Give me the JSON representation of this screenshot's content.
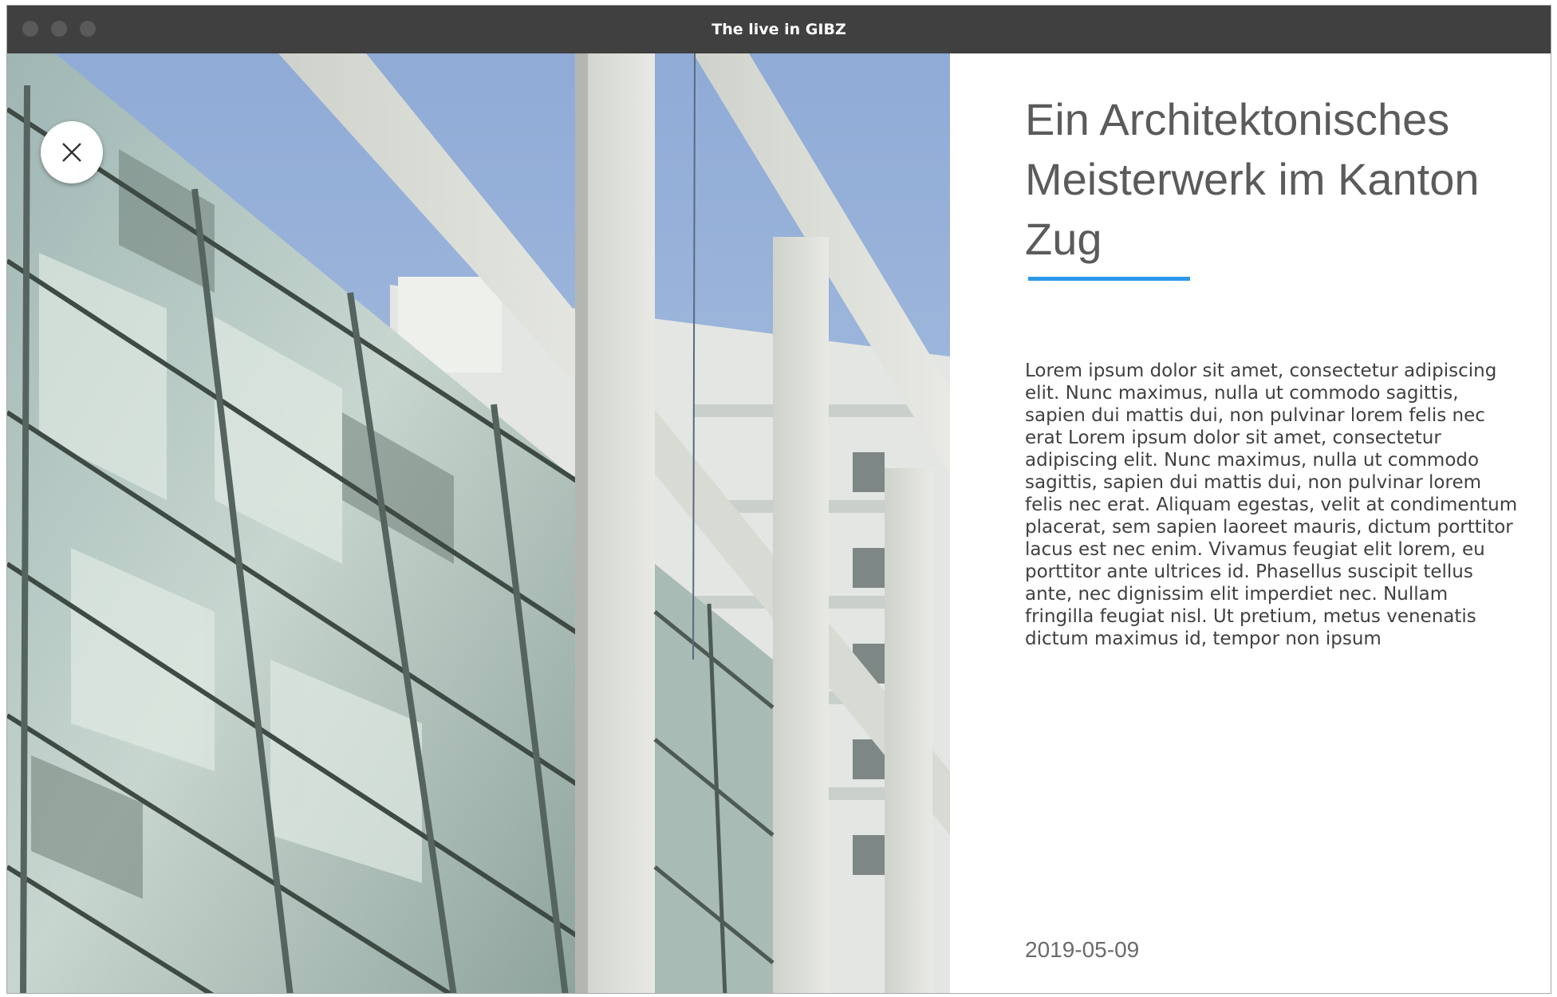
{
  "window": {
    "title": "The live in GIBZ"
  },
  "close_button": {
    "icon": "close-icon"
  },
  "article": {
    "headline": "Ein Architektonisches Meisterwerk im Kanton Zug",
    "body": "Lorem ipsum dolor sit amet, consectetur adipiscing elit. Nunc maximus, nulla ut commodo sagittis, sapien dui mattis dui, non pulvinar lorem felis nec erat Lorem ipsum dolor sit amet, consectetur adipiscing elit. Nunc maximus, nulla ut commodo sagittis, sapien dui mattis dui, non pulvinar lorem felis nec erat. Aliquam egestas, velit at condimentum placerat, sem sapien laoreet mauris, dictum porttitor lacus est nec enim. Vivamus feugiat elit lorem, eu porttitor ante ultrices id. Phasellus suscipit tellus ante, nec dignissim elit imperdiet nec. Nullam fringilla feugiat nisl. Ut pretium, metus venenatis dictum maximus id, tempor non ipsum",
    "date": "2019-05-09"
  },
  "colors": {
    "titlebar": "#404040",
    "accent": "#2b97e9",
    "headline": "#5b5b5b",
    "body_text": "#404040"
  }
}
